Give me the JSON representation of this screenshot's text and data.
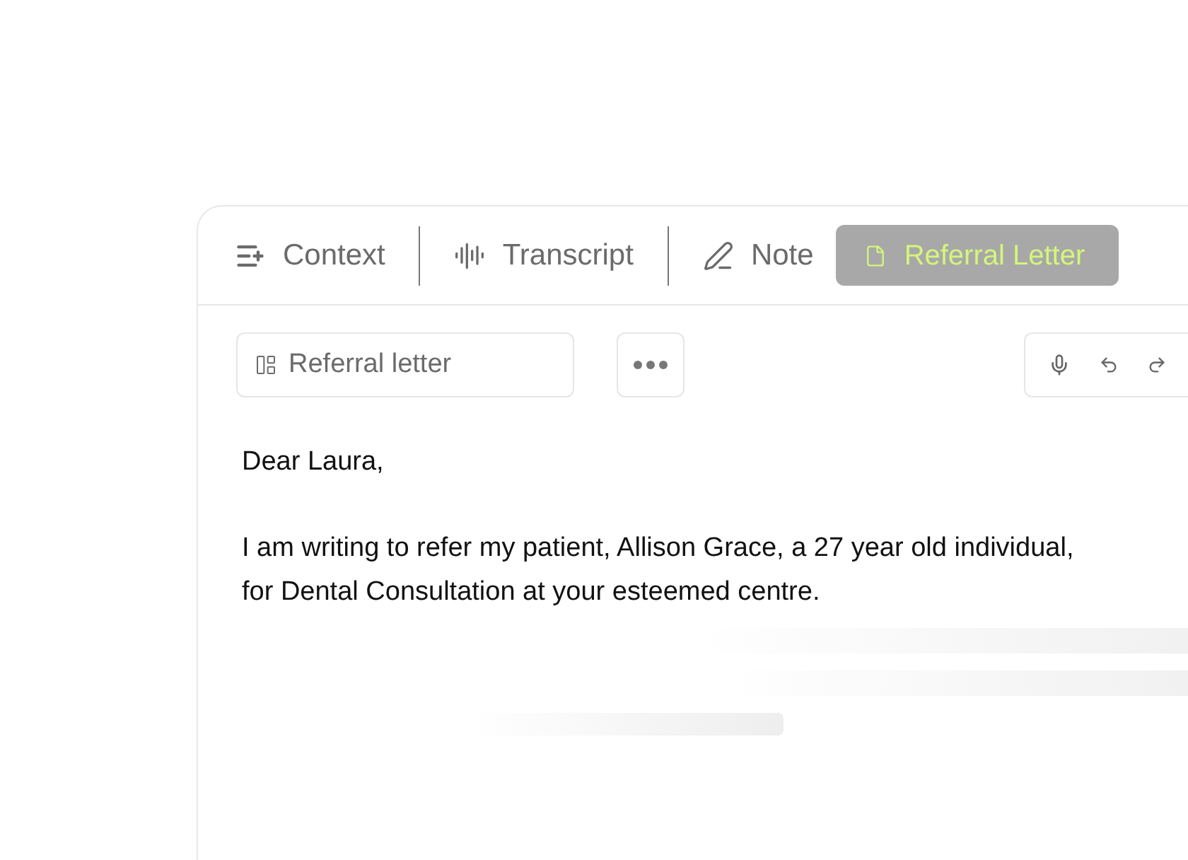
{
  "tabs": [
    {
      "kind": "context",
      "label": "Context",
      "selected": false
    },
    {
      "kind": "transcript",
      "label": "Transcript",
      "selected": false
    },
    {
      "kind": "note",
      "label": "Note",
      "selected": false
    },
    {
      "kind": "letter",
      "label": "Referral Letter",
      "selected": true
    }
  ],
  "template": {
    "label": "Referral letter"
  },
  "letter": {
    "paragraphs": [
      "Dear Laura,",
      "I am writing to refer my patient, Allison Grace, a 27 year old individual, for Dental Consultation at your esteemed centre."
    ]
  }
}
